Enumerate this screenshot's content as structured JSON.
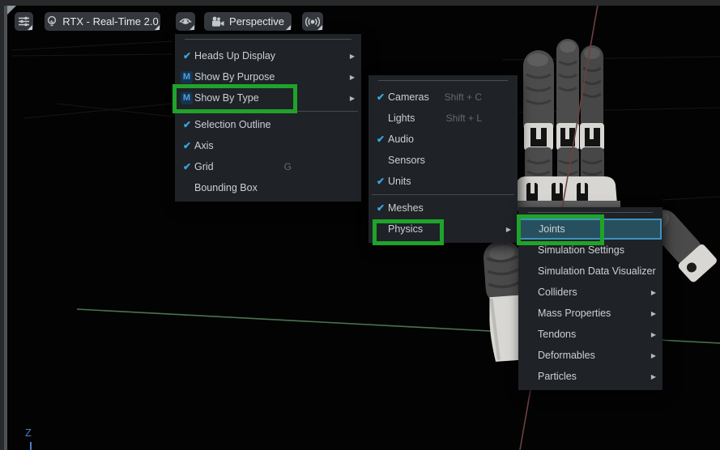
{
  "glyphs": {
    "check": "✔",
    "submenu_arrow": "▶",
    "m_badge": "M"
  },
  "toolbar": {
    "render_mode": {
      "label": "RTX - Real-Time 2.0",
      "icon": "lightbulb-icon"
    },
    "camera": {
      "label": "Perspective",
      "icon": "video-camera-icon"
    },
    "settings_icon": "sliders-icon",
    "visibility_icon": "eye-icon",
    "broadcast_icon": "broadcast-icon"
  },
  "menus": {
    "display": {
      "items": [
        {
          "label": "Heads Up Display",
          "checked": true,
          "submenu": true
        },
        {
          "label": "Show By Purpose",
          "badge": "M",
          "submenu": true
        },
        {
          "label": "Show By Type",
          "badge": "M",
          "submenu": true
        },
        {
          "label": "Selection Outline",
          "checked": true
        },
        {
          "label": "Axis",
          "checked": true
        },
        {
          "label": "Grid",
          "checked": true,
          "shortcut": "G"
        },
        {
          "label": "Bounding Box"
        }
      ]
    },
    "show_by_type": {
      "items": [
        {
          "label": "Cameras",
          "checked": true,
          "shortcut": "Shift + C"
        },
        {
          "label": "Lights",
          "shortcut": "Shift + L"
        },
        {
          "label": "Audio",
          "checked": true
        },
        {
          "label": "Sensors"
        },
        {
          "label": "Units",
          "checked": true
        },
        {
          "label": "Meshes",
          "checked": true
        },
        {
          "label": "Physics",
          "submenu": true
        }
      ]
    },
    "physics": {
      "items": [
        {
          "label": "Joints",
          "highlighted": true
        },
        {
          "label": "Simulation Settings"
        },
        {
          "label": "Simulation Data Visualizer"
        },
        {
          "label": "Colliders",
          "submenu": true
        },
        {
          "label": "Mass Properties",
          "submenu": true
        },
        {
          "label": "Tendons",
          "submenu": true
        },
        {
          "label": "Deformables",
          "submenu": true
        },
        {
          "label": "Particles",
          "submenu": true
        }
      ]
    }
  },
  "viewport": {
    "axis_gizmo_label": "Z"
  },
  "colors": {
    "annotation_green": "#1fa32b",
    "accent_check_blue": "#35a7e0",
    "highlight_bg": "#27505f",
    "highlight_border": "#3f93bb",
    "axis_green": "#4a7450",
    "axis_red": "#6e4040",
    "axis_z_blue": "#4e7dc0",
    "menu_bg": "#1f2227",
    "toolbar_button_bg": "#34383d"
  }
}
